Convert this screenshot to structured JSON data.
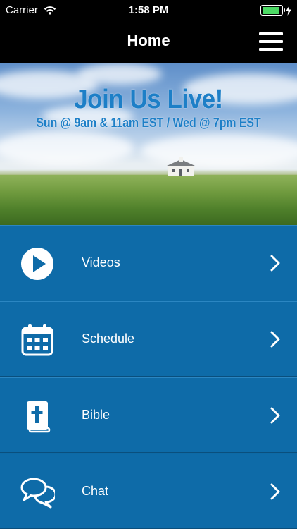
{
  "status_bar": {
    "carrier": "Carrier",
    "time": "1:58 PM",
    "battery_fill": 0.92
  },
  "nav": {
    "title": "Home"
  },
  "banner": {
    "title": "Join Us Live!",
    "subtitle": "Sun @ 9am & 11am EST / Wed @ 7pm EST"
  },
  "menu": {
    "items": [
      {
        "label": "Videos",
        "icon": "play-circle-icon"
      },
      {
        "label": "Schedule",
        "icon": "calendar-icon"
      },
      {
        "label": "Bible",
        "icon": "bible-icon"
      },
      {
        "label": "Chat",
        "icon": "chat-bubbles-icon"
      }
    ]
  },
  "colors": {
    "accent": "#0e6ba8",
    "banner_text": "#1d7fc7",
    "battery": "#4cd964"
  }
}
